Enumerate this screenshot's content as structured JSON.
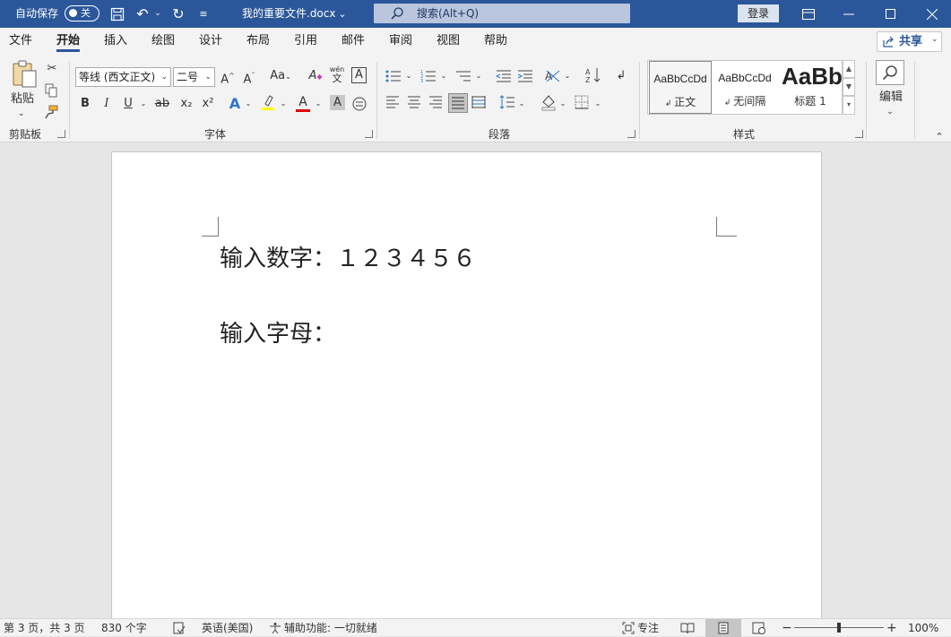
{
  "title_bar": {
    "autosave_label": "自动保存",
    "autosave_state": "关",
    "filename": "我的重要文件.docx",
    "search_placeholder": "搜索(Alt+Q)",
    "login_label": "登录"
  },
  "menu": {
    "items": [
      "文件",
      "开始",
      "插入",
      "绘图",
      "设计",
      "布局",
      "引用",
      "邮件",
      "审阅",
      "视图",
      "帮助"
    ],
    "active": "开始",
    "share_label": "共享"
  },
  "ribbon": {
    "clipboard": {
      "paste_label": "粘贴",
      "group_label": "剪贴板"
    },
    "font": {
      "font_name": "等线 (西文正文)",
      "font_size": "二号",
      "group_label": "字体",
      "phonetic_top": "wén",
      "phonetic_bottom": "文",
      "bold": "B",
      "italic": "I",
      "underline": "U",
      "strike": "ab",
      "subscript": "x₂",
      "superscript": "x²",
      "grow": "A^",
      "shrink": "Aˇ",
      "case": "Aa",
      "font_color_label": "A",
      "text_effect_label": "A",
      "shading_label": "A",
      "highlight_color": "#ffff00",
      "font_color": "#e00000"
    },
    "paragraph": {
      "group_label": "段落"
    },
    "styles": {
      "group_label": "样式",
      "items": [
        {
          "preview": "AaBbCcDd",
          "name": "正文"
        },
        {
          "preview": "AaBbCcDd",
          "name": "无间隔"
        },
        {
          "preview": "AaBb",
          "name": "标题 1"
        }
      ]
    },
    "editing": {
      "label": "编辑"
    }
  },
  "document": {
    "line1": "输入数字：１２３４５６",
    "line2": "输入字母："
  },
  "status_bar": {
    "page": "第 3 页，共 3 页",
    "words": "830 个字",
    "language": "英语(美国)",
    "accessibility": "辅助功能: 一切就绪",
    "focus": "专注",
    "zoom": "100%"
  },
  "colors": {
    "brand": "#2b579a"
  }
}
